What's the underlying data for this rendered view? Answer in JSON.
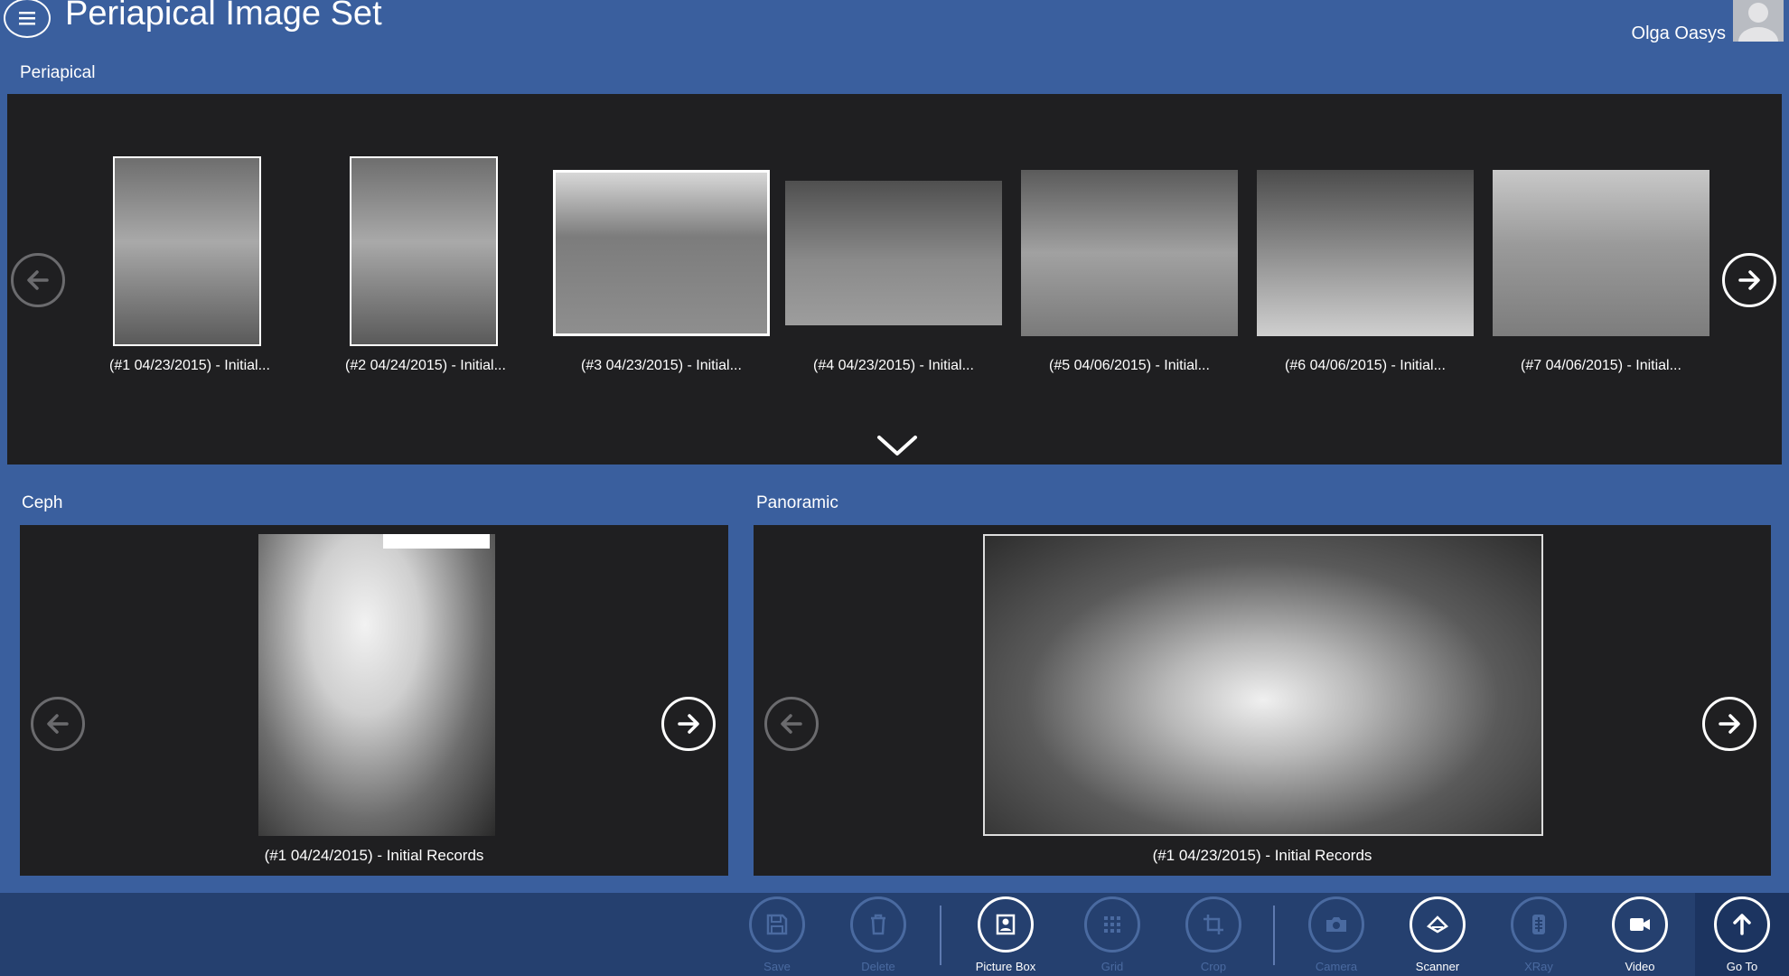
{
  "header": {
    "title": "Periapical Image Set",
    "user_name": "Olga Oasys"
  },
  "periapical": {
    "label": "Periapical",
    "thumbnails": [
      {
        "caption": "(#1 04/23/2015) - Initial..."
      },
      {
        "caption": "(#2 04/24/2015) - Initial..."
      },
      {
        "caption": "(#3 04/23/2015) - Initial..."
      },
      {
        "caption": "(#4 04/23/2015) - Initial..."
      },
      {
        "caption": "(#5 04/06/2015) - Initial..."
      },
      {
        "caption": "(#6 04/06/2015) - Initial..."
      },
      {
        "caption": "(#7 04/06/2015) - Initial..."
      }
    ]
  },
  "ceph": {
    "label": "Ceph",
    "caption": "(#1 04/24/2015) - Initial Records"
  },
  "panoramic": {
    "label": "Panoramic",
    "caption": "(#1 04/23/2015) - Initial Records"
  },
  "toolbar": {
    "save": "Save",
    "delete": "Delete",
    "picture_box": "Picture Box",
    "grid": "Grid",
    "crop": "Crop",
    "camera": "Camera",
    "scanner": "Scanner",
    "xray": "XRay",
    "video": "Video",
    "go_to": "Go To"
  },
  "colors": {
    "background": "#3a5f9e",
    "panel": "#1f1f21",
    "toolbar": "#25406f"
  }
}
